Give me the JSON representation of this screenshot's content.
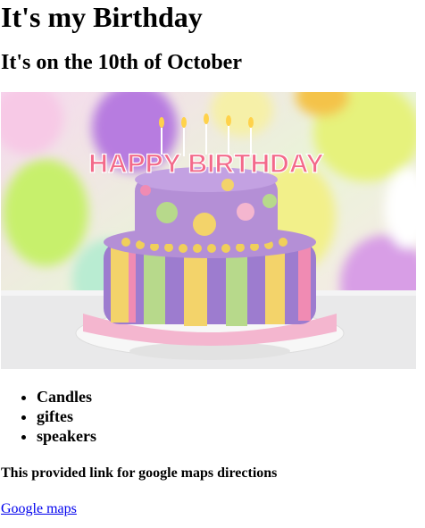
{
  "heading": "It's my Birthday",
  "subheading": "It's on the 10th of October",
  "image": {
    "banner_text": "HAPPY BIRTHDAY",
    "colors": {
      "cake_top": "#b48fd6",
      "cake_bottom": "#9d7ccf",
      "ribbon": "#f4b6cf",
      "stripe_yellow": "#f3d36a",
      "stripe_green": "#b7d98b",
      "stripe_pink": "#f08bb3"
    }
  },
  "items": [
    "Candles",
    "giftes",
    "speakers"
  ],
  "directions_note": "This provided link for google maps directions",
  "map_link": {
    "label": "Google maps"
  }
}
